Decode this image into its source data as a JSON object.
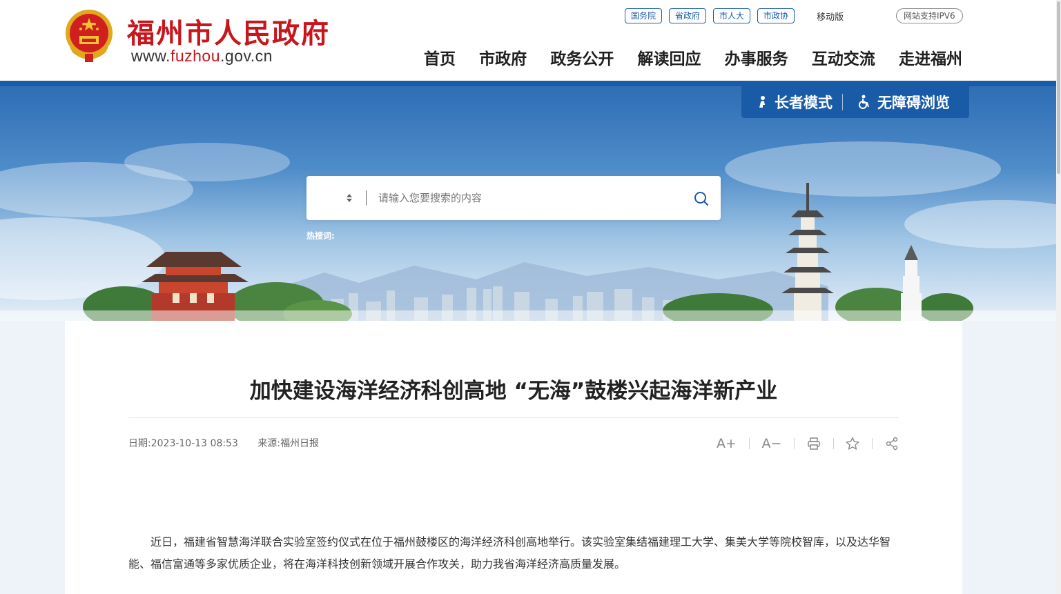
{
  "header": {
    "site_title": "福州市人民政府",
    "site_url_prefix": "www.",
    "site_url_highlight": "fuzhou",
    "site_url_suffix": ".gov.cn",
    "top_links": [
      "国务院",
      "省政府",
      "市人大",
      "市政协"
    ],
    "mobile_label": "移动版",
    "ipv6_label": "网站支持IPV6",
    "nav": [
      "首页",
      "市政府",
      "政务公开",
      "解读回应",
      "办事服务",
      "互动交流",
      "走进福州"
    ]
  },
  "banner": {
    "elder_mode_label": "长者模式",
    "accessible_label": "无障碍浏览",
    "search_placeholder": "请输入您要搜索的内容",
    "hot_words_label": "热搜词:"
  },
  "article": {
    "title": "加快建设海洋经济科创高地 “无海”鼓楼兴起海洋新产业",
    "date_label": "日期:",
    "date_value": "2023-10-13 08:53",
    "source_label": "来源:",
    "source_value": "福州日报",
    "tools": {
      "font_increase": "A+",
      "font_decrease": "A−"
    },
    "body": "近日，福建省智慧海洋联合实验室签约仪式在位于福州鼓楼区的海洋经济科创高地举行。该实验室集结福建理工大学、集美大学等院校智库，以及达华智能、福信富通等多家优质企业，将在海洋科技创新领域开展合作攻关，助力我省海洋经济高质量发展。"
  },
  "colors": {
    "brand_red": "#c8161d",
    "brand_blue": "#1a5ba8"
  },
  "icons": [
    "national-emblem-icon",
    "elder-icon",
    "wheelchair-icon",
    "select-arrows-icon",
    "search-icon",
    "print-icon",
    "star-icon",
    "share-icon"
  ]
}
